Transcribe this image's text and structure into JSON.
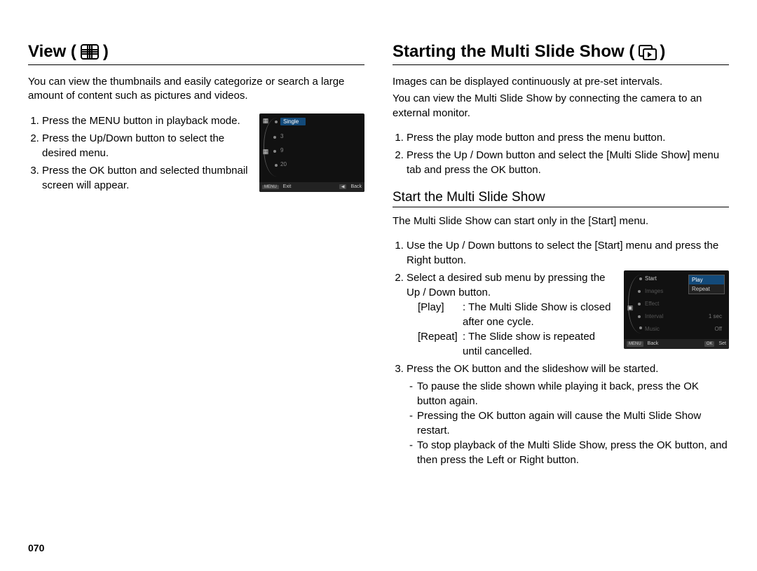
{
  "page_number": "070",
  "left": {
    "title": "View (",
    "title_end": ")",
    "intro": "You can view the thumbnails and easily categorize or search a large amount of content such as pictures and videos.",
    "steps": [
      "Press the MENU button in playback mode.",
      "Press the Up/Down button to select the desired menu.",
      "Press the OK button and selected thumbnail screen will appear."
    ],
    "screen": {
      "items": [
        "Single",
        "3",
        "9",
        "20"
      ],
      "footer": {
        "left_tag": "MENU",
        "left_label": "Exit",
        "right_tag": "◀",
        "right_label": "Back"
      }
    }
  },
  "right": {
    "title": "Starting the Multi Slide Show (",
    "title_end": ")",
    "intro_lines": [
      "Images can be displayed continuously at pre-set intervals.",
      "You can view the Multi Slide Show by connecting the camera to an external monitor."
    ],
    "intro_steps": [
      "Press the play mode button and press the menu button.",
      "Press the Up / Down button and select the [Multi Slide Show] menu tab and press the OK button."
    ],
    "sub_heading": "Start the Multi Slide Show",
    "sub_intro": "The Multi Slide Show can start only in the [Start] menu.",
    "sub_steps": {
      "s1": "Use the Up / Down buttons to select the [Start] menu and press the Right button.",
      "s2": "Select a desired sub menu by pressing the Up / Down button.",
      "play_term": "[Play]",
      "play_def": ": The Multi Slide Show is closed after one cycle.",
      "repeat_term": "[Repeat]",
      "repeat_def": ": The Slide show is repeated until cancelled.",
      "s3": "Press the OK button and the slideshow will be started.",
      "notes": [
        "To pause the slide shown while playing it back, press the OK button again.",
        "Pressing the OK button again will cause the Multi Slide Show restart.",
        "To stop playback of the Multi Slide Show, press the OK button, and then press the Left or Right button."
      ]
    },
    "screen": {
      "left_items": [
        "Start",
        "Images",
        "Effect",
        "Interval",
        "Music"
      ],
      "right_values": [
        "",
        "",
        "",
        "1 sec",
        "Off"
      ],
      "submenu": [
        "Play",
        "Repeat"
      ],
      "footer": {
        "left_tag": "MENU",
        "left_label": "Back",
        "right_tag": "OK",
        "right_label": "Set"
      }
    }
  }
}
